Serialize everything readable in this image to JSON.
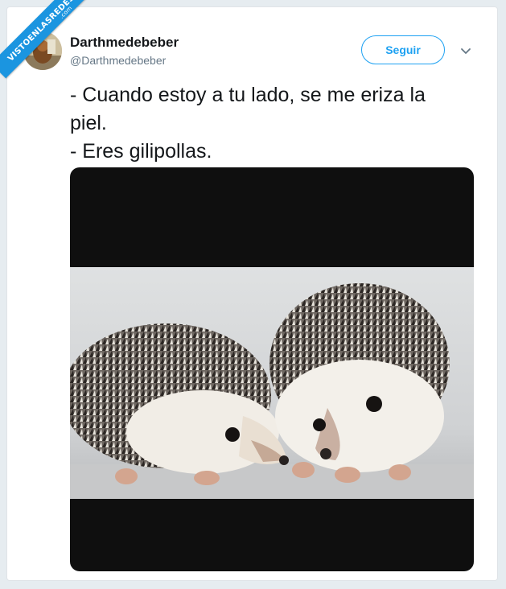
{
  "watermark": {
    "text": "VISTOENLASREDES",
    "suffix": ".com"
  },
  "tweet": {
    "display_name": "Darthmedebeber",
    "handle": "@Darthmedebeber",
    "follow_label": "Seguir",
    "text_lines": [
      "- Cuando estoy a tu lado, se me eriza la",
      "piel.",
      "- Eres gilipollas."
    ]
  },
  "colors": {
    "accent": "#1da1f2",
    "ribbon": "#1b95e0",
    "text": "#14171a",
    "muted": "#657786"
  },
  "icons": {
    "more": "chevron-down-icon"
  }
}
